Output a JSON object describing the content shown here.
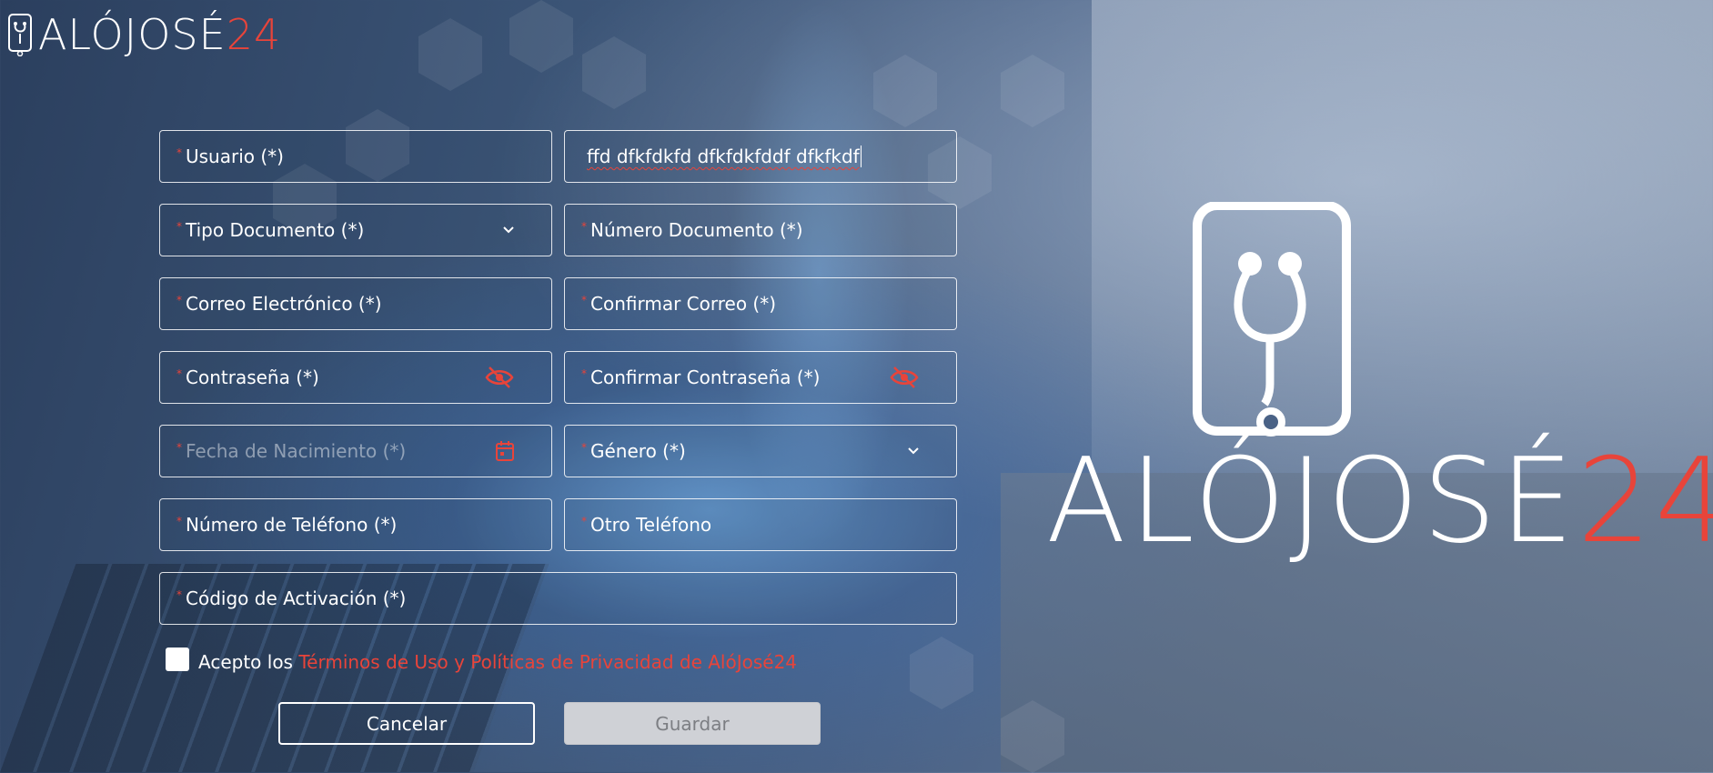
{
  "brand": {
    "name_main": "ALÓJOSÉ",
    "name_accent": "24",
    "accent_color": "#e8443a"
  },
  "form": {
    "usuario": {
      "label": "Usuario (*)"
    },
    "nombre": {
      "value": "ffd dfkfdkfd dfkfdkfddf dfkfkdf"
    },
    "tipo_documento": {
      "label": "Tipo Documento (*)"
    },
    "numero_documento": {
      "label": "Número Documento (*)"
    },
    "correo": {
      "label": "Correo Electrónico (*)"
    },
    "confirmar_correo": {
      "label": "Confirmar Correo (*)"
    },
    "contrasena": {
      "label": "Contraseña (*)"
    },
    "confirmar_contrasena": {
      "label": "Confirmar Contraseña (*)"
    },
    "fecha_nacimiento": {
      "placeholder": "Fecha de Nacimiento (*)"
    },
    "genero": {
      "label": "Género (*)"
    },
    "telefono": {
      "label": "Número de Teléfono (*)"
    },
    "otro_telefono": {
      "label": "Otro Teléfono"
    },
    "codigo_activacion": {
      "label": "Código de Activación (*)"
    },
    "required_marker": "*"
  },
  "terms": {
    "prefix": "Acepto los",
    "link": "Términos de Uso y Políticas de Privacidad de AlóJosé24",
    "checked": false
  },
  "buttons": {
    "cancel": "Cancelar",
    "save": "Guardar"
  },
  "icons": {
    "password_toggle": "eye-slash-icon",
    "date_picker": "calendar-icon",
    "dropdown": "chevron-down-icon",
    "brand_mark": "stethoscope-icon"
  }
}
